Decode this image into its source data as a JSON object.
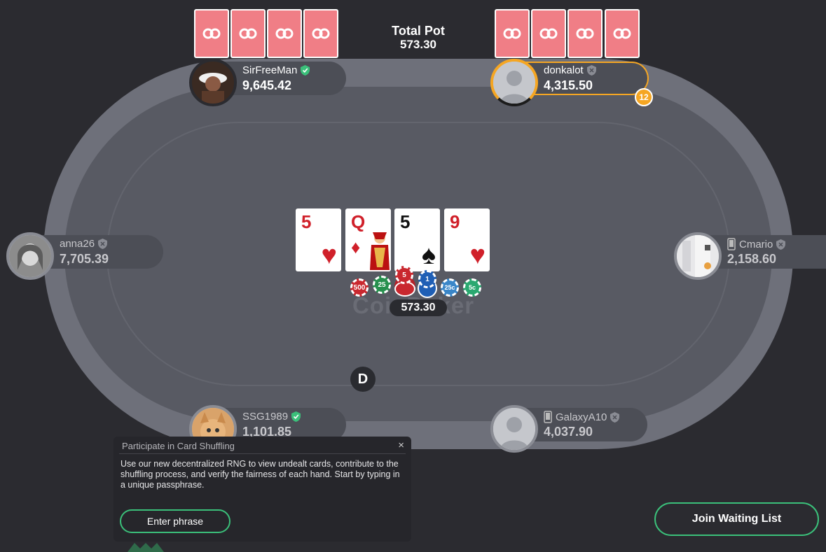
{
  "pot": {
    "label": "Total Pot",
    "value": "573.30",
    "center_value": "573.30"
  },
  "watermark": "CoinPoker",
  "players": {
    "sirfreeman": {
      "name": "SirFreeMan",
      "stack": "9,645.42",
      "verified": true
    },
    "donkalot": {
      "name": "donkalot",
      "stack": "4,315.50",
      "timer": "12"
    },
    "anna26": {
      "name": "anna26",
      "stack": "7,705.39"
    },
    "cmario": {
      "name": "Cmario",
      "stack": "2,158.60"
    },
    "ssg1989": {
      "name": "SSG1989",
      "stack": "1,101.85",
      "verified": true
    },
    "galaxya10": {
      "name": "GalaxyA10",
      "stack": "4,037.90"
    }
  },
  "community_cards": [
    {
      "rank": "5",
      "suit": "♥",
      "color": "red"
    },
    {
      "rank": "Q",
      "suit": "♦",
      "color": "red"
    },
    {
      "rank": "5",
      "suit": "♠",
      "color": "black"
    },
    {
      "rank": "9",
      "suit": "♥",
      "color": "red"
    }
  ],
  "chips": [
    "500",
    "25",
    "5",
    "1",
    "25c",
    "5c"
  ],
  "dealer_button": "D",
  "shuffle_panel": {
    "title": "Participate in Card Shuffling",
    "close": "×",
    "description": "Use our new decentralized RNG to view undealt cards, contribute to the shuffling process, and verify the fairness of each hand. Start by typing in a unique passphrase.",
    "button": "Enter phrase"
  },
  "join_button": "Join Waiting List",
  "colors": {
    "accent_green": "#3bc07a",
    "card_back": "#f07e86",
    "timer": "#f5a623"
  }
}
